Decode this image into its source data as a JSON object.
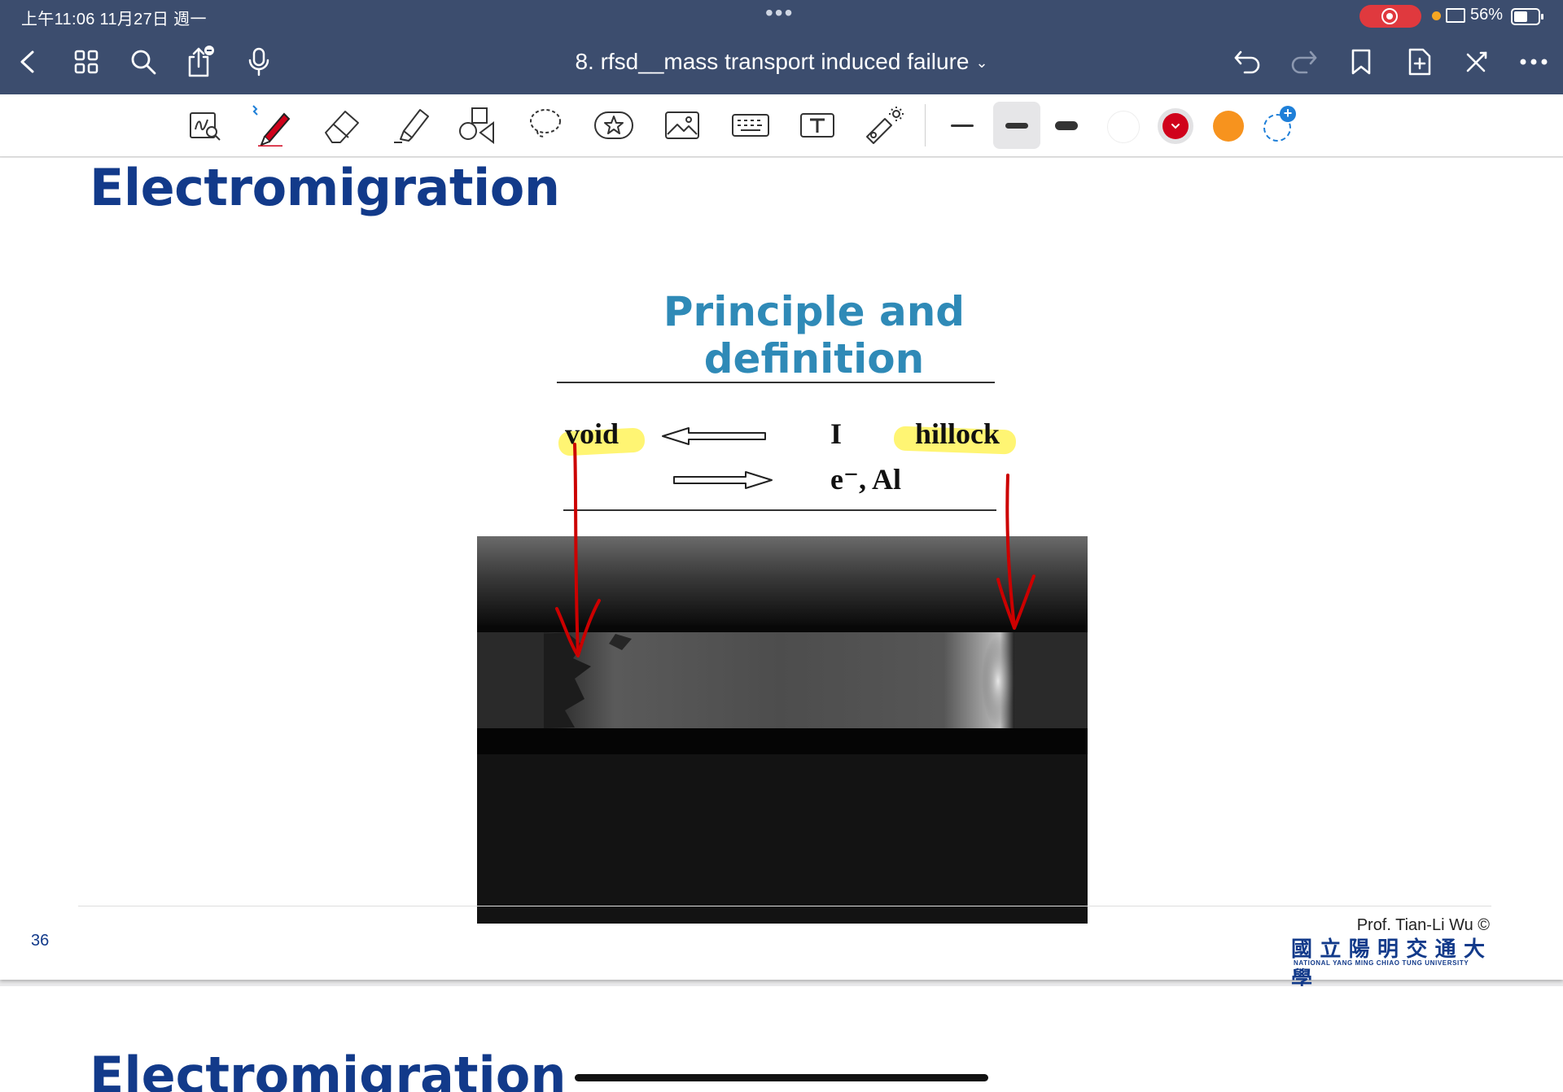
{
  "status": {
    "time": "上午11:06   11月27日 週一",
    "dots": "•••",
    "battery": "56%"
  },
  "nav": {
    "title": "8. rfsd__mass transport induced failure",
    "title_chevron": "⌄"
  },
  "toolbar": {
    "tools": [
      "zoom-lasso",
      "pen",
      "eraser",
      "highlighter",
      "shapes",
      "lasso",
      "sticker",
      "image",
      "keyboard",
      "text",
      "laser-pointer"
    ],
    "selected_tool": "pen",
    "stroke_widths": [
      "thin",
      "medium",
      "thick"
    ],
    "selected_width": "medium",
    "colors": [
      "#ffffff",
      "#d0021b",
      "#f7931e"
    ],
    "selected_color": "#d0021b"
  },
  "slide": {
    "title": "Electromigration",
    "subtitle": "Principle and definition",
    "void": "void",
    "current": "I",
    "hillock": "hillock",
    "electrons": "e⁻, Al",
    "page_number": "36",
    "credit": "Prof. Tian-Li Wu ©",
    "university_cn": "國立陽明交通大學",
    "university_en": "NATIONAL YANG MING CHIAO TUNG UNIVERSITY"
  },
  "next_slide": {
    "title": "Electromigration"
  }
}
